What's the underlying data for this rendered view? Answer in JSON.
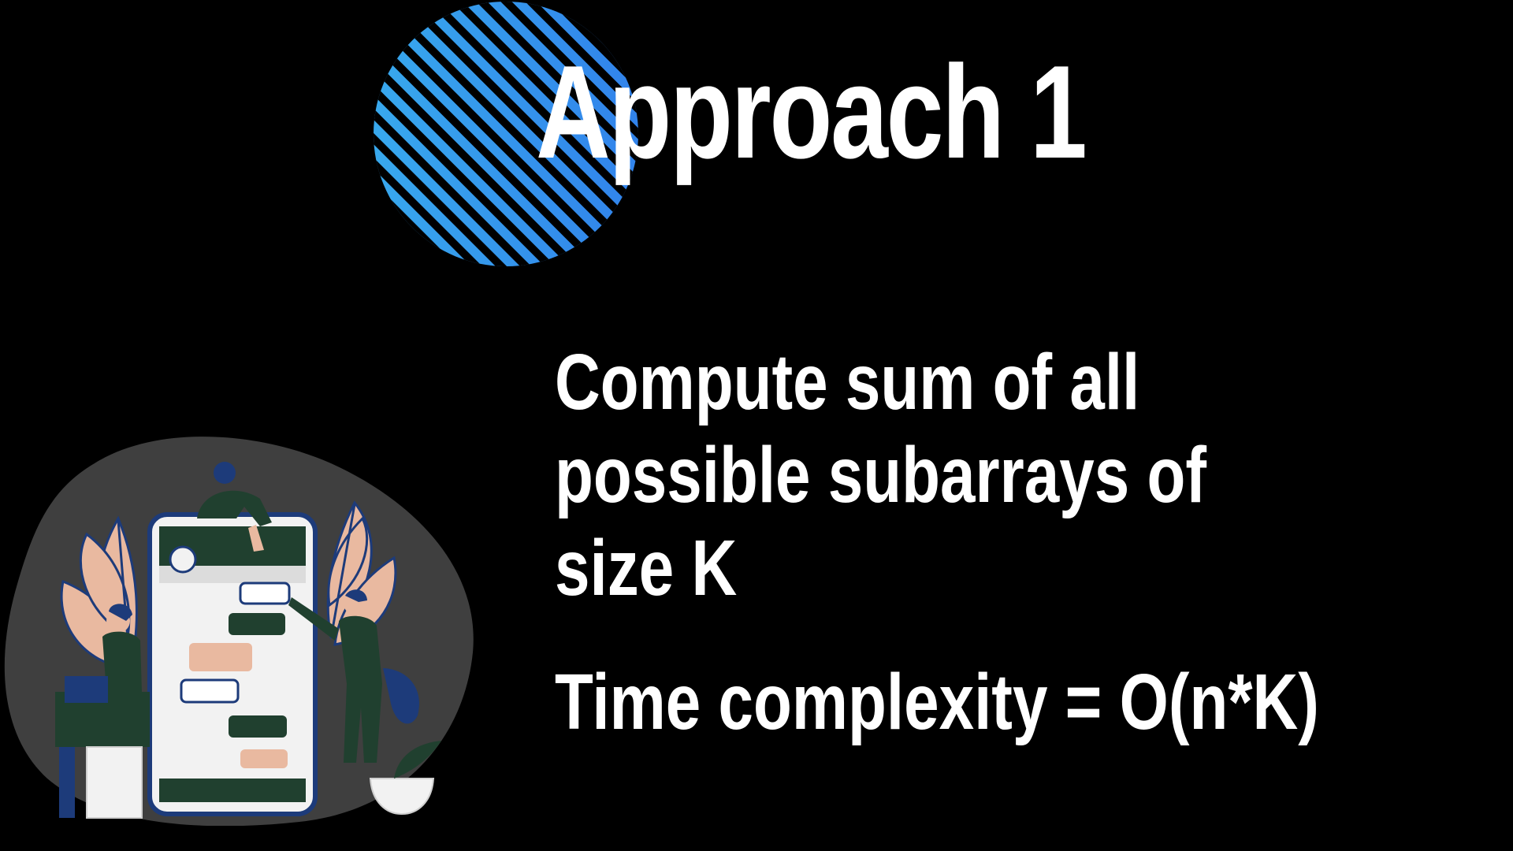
{
  "slide": {
    "title": "Approach 1",
    "description_lines": [
      "Compute sum of all",
      "possible subarrays of",
      "size K"
    ],
    "complexity": "Time complexity = O(n*K)"
  },
  "colors": {
    "background": "#000000",
    "text": "#ffffff",
    "circle_stripe_light": "#3fd0f0",
    "circle_stripe_dark": "#2a5be8",
    "blob": "#3f3f3f",
    "leaf": "#e9b9a0",
    "dark_green": "#20402f",
    "navy": "#1d3b7a"
  },
  "icons": {
    "decoration": "striped-circle",
    "illustration": "people-with-phone-chat"
  }
}
